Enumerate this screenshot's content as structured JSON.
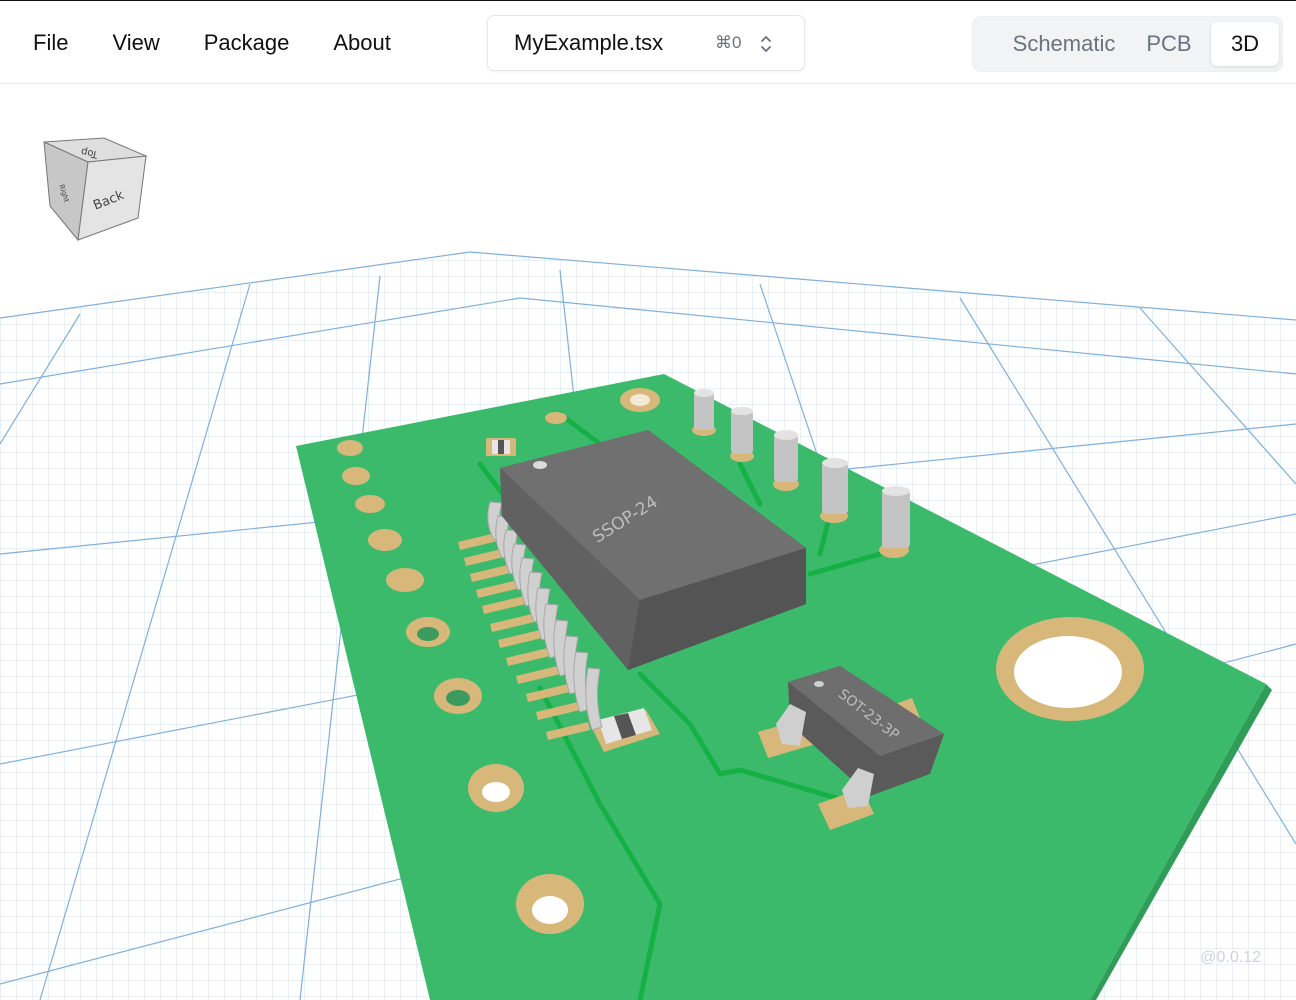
{
  "menu": {
    "items": [
      {
        "label": "File"
      },
      {
        "label": "View"
      },
      {
        "label": "Package"
      },
      {
        "label": "About"
      }
    ]
  },
  "file_selector": {
    "filename": "MyExample.tsx",
    "shortcut": "⌘0",
    "chevron_icon": "chevron-up-down-icon"
  },
  "view_tabs": {
    "items": [
      {
        "label": "Schematic",
        "active": false
      },
      {
        "label": "PCB",
        "active": false
      },
      {
        "label": "3D",
        "active": true
      }
    ]
  },
  "orientation_cube": {
    "faces": {
      "top": "Top",
      "front": "Back",
      "side": "Right"
    }
  },
  "components": {
    "ic_main": "SSOP-24",
    "ic_small": "SOT-23-3P"
  },
  "colors": {
    "board": "#3cba6c",
    "trace": "#16b146",
    "pad": "#d8b87a",
    "ic_body": "#6b6b6b",
    "grid_major": "#6aa3d8",
    "grid_minor": "#c9d9ea",
    "active_tab_bg": "#ffffff"
  },
  "footer": {
    "version": "@0.0.12"
  }
}
